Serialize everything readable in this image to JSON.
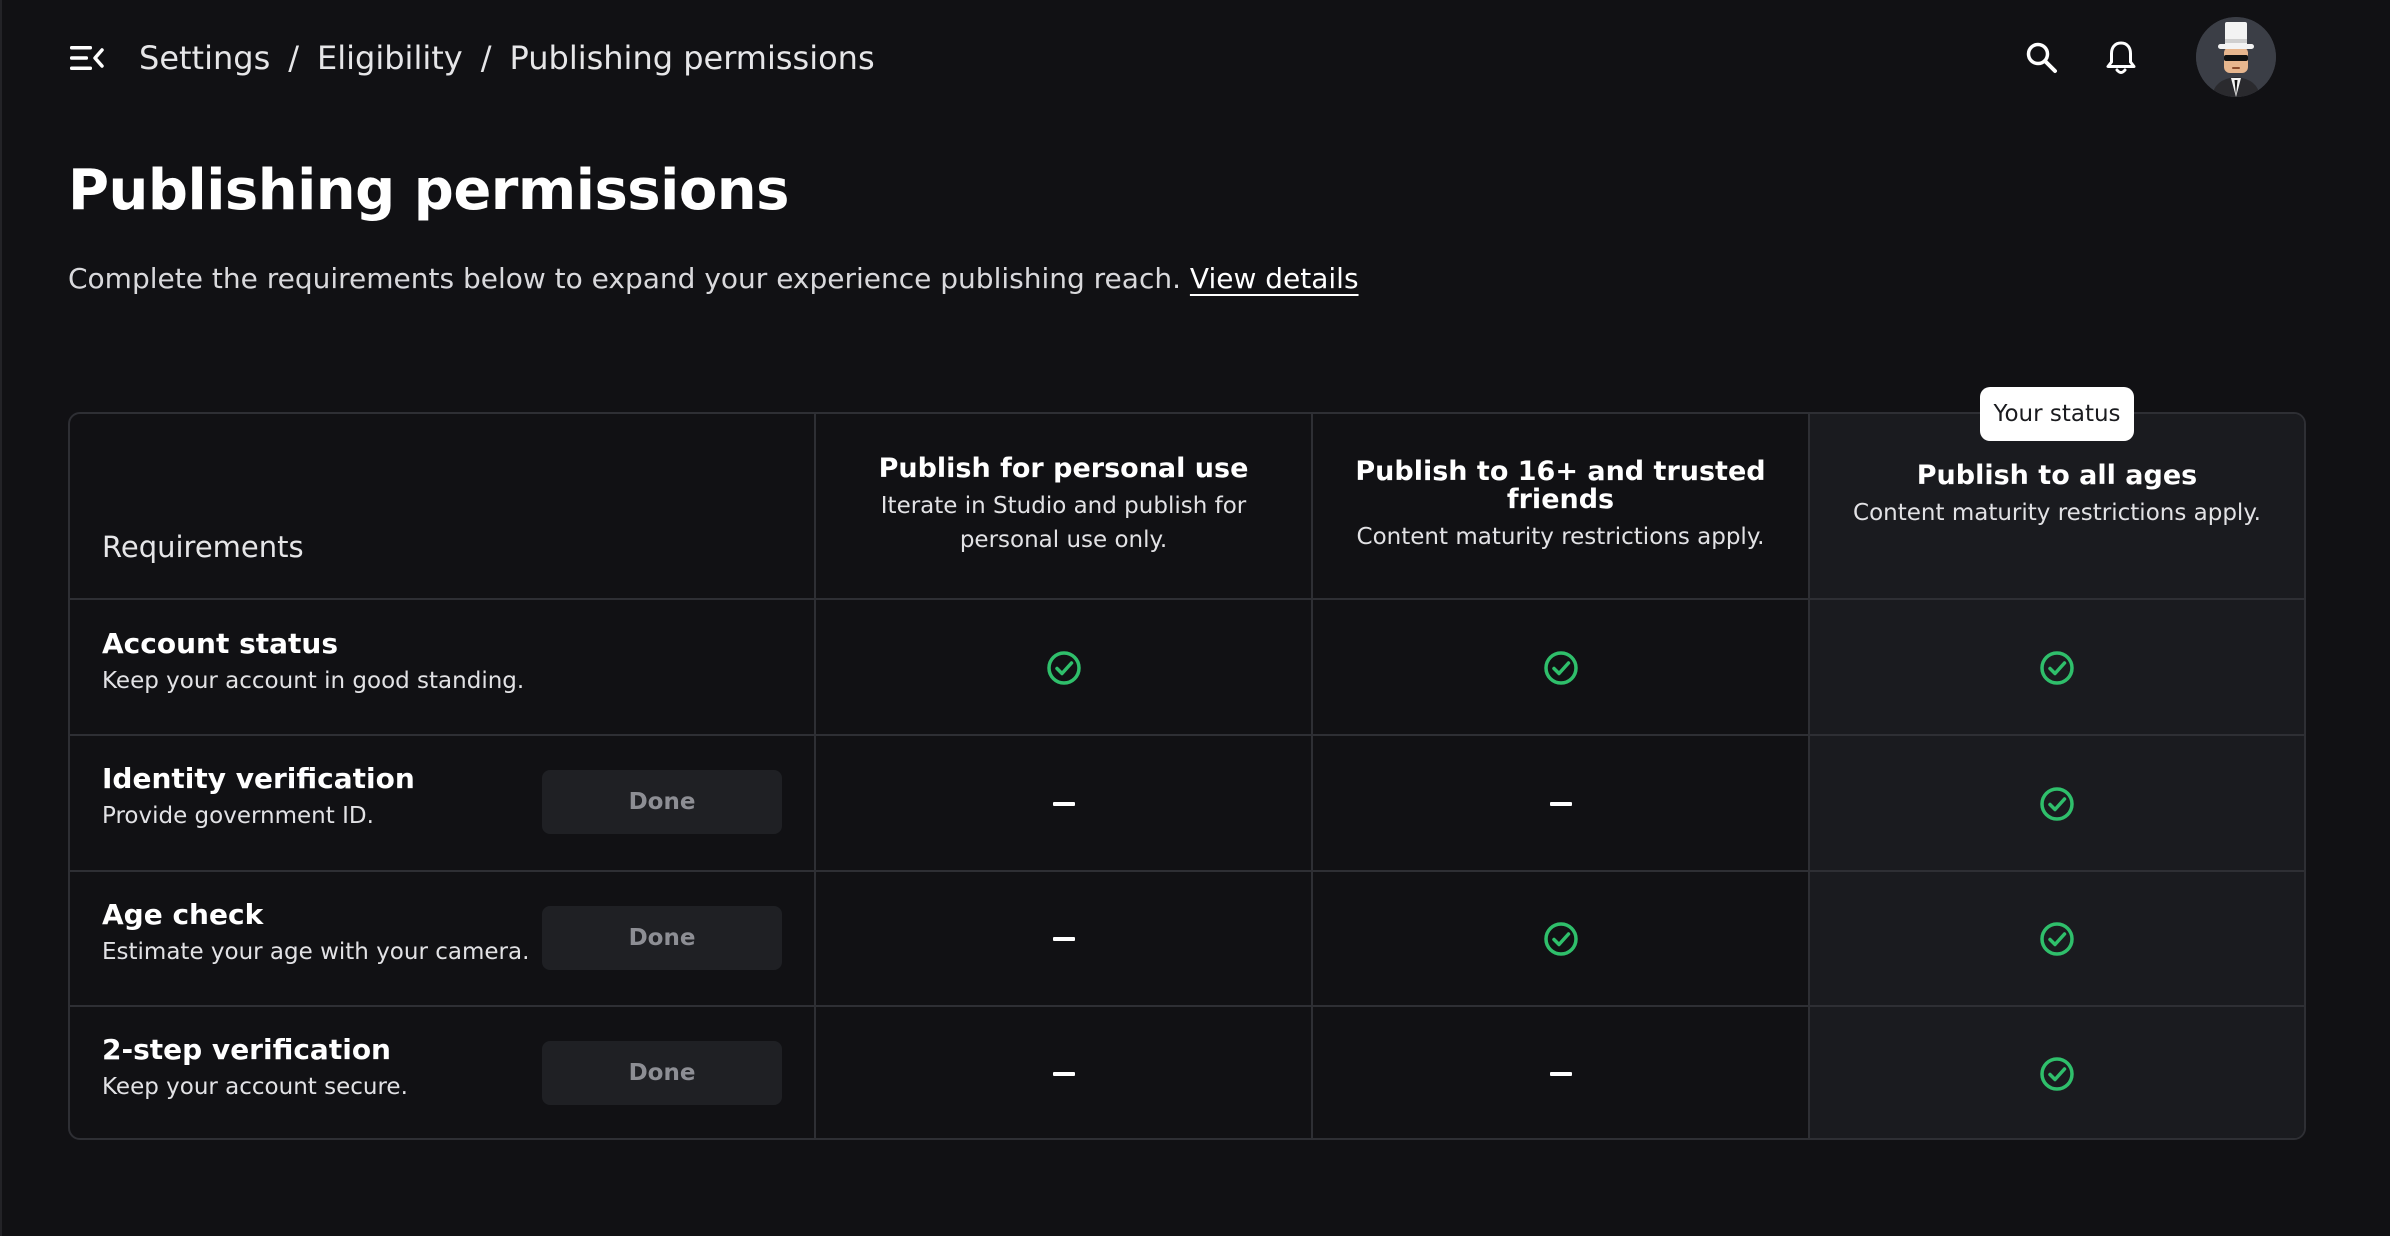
{
  "topbar": {
    "breadcrumb": [
      {
        "label": "Settings"
      },
      {
        "label": "Eligibility"
      },
      {
        "label": "Publishing permissions"
      }
    ],
    "separator": "/",
    "icons": {
      "menu": "menu-collapse-icon",
      "search": "search-icon",
      "notifications": "bell-icon",
      "avatar": "avatar"
    }
  },
  "header": {
    "title": "Publishing permissions",
    "subtitle": "Complete the requirements below to expand your experience publishing reach.",
    "link": "View details"
  },
  "status_badge": "Your status",
  "table": {
    "requirements_header": "Requirements",
    "tiers": [
      {
        "title": "Publish for personal use",
        "desc": "Iterate in Studio and publish for personal use only."
      },
      {
        "title": "Publish to 16+ and trusted friends",
        "desc": "Content maturity restrictions apply."
      },
      {
        "title": "Publish to all ages",
        "desc": "Content maturity restrictions apply.",
        "current": true
      }
    ],
    "rows": [
      {
        "title": "Account status",
        "desc": "Keep your account in good standing.",
        "button": null,
        "cells": [
          "check",
          "check",
          "check"
        ]
      },
      {
        "title": "Identity verification",
        "desc": "Provide government ID.",
        "button": "Done",
        "cells": [
          "dash",
          "dash",
          "check"
        ]
      },
      {
        "title": "Age check",
        "desc": "Estimate your age with your camera.",
        "button": "Done",
        "cells": [
          "dash",
          "check",
          "check"
        ]
      },
      {
        "title": "2-step verification",
        "desc": "Keep your account secure.",
        "button": "Done",
        "cells": [
          "dash",
          "dash",
          "check"
        ]
      }
    ]
  },
  "colors": {
    "background": "#111114",
    "check_green": "#2fbf6b",
    "current_tier_bg": "#1a1b1f",
    "border": "#2e2f34"
  }
}
